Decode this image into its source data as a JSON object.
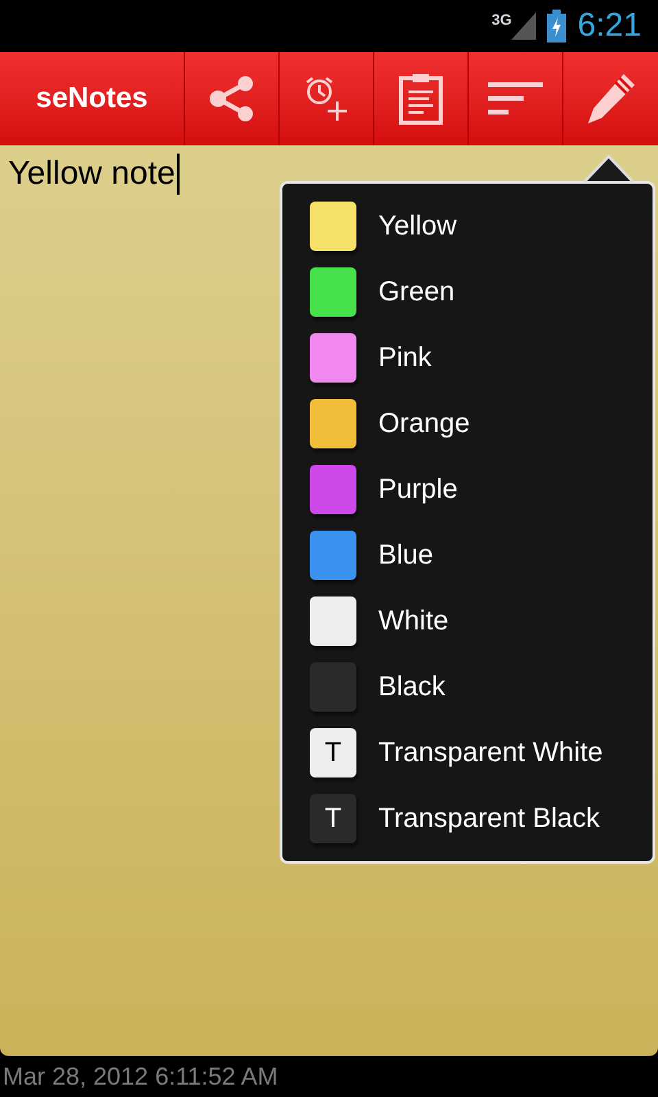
{
  "status_bar": {
    "network": "3G",
    "time": "6:21"
  },
  "toolbar": {
    "title": "seNotes"
  },
  "note": {
    "value": "Yellow note"
  },
  "color_menu": [
    {
      "label": "Yellow",
      "color": "#f5e06a",
      "kind": "plain"
    },
    {
      "label": "Green",
      "color": "#45e04a",
      "kind": "plain"
    },
    {
      "label": "Pink",
      "color": "#f088ee",
      "kind": "plain"
    },
    {
      "label": "Orange",
      "color": "#f2be3a",
      "kind": "plain"
    },
    {
      "label": "Purple",
      "color": "#cc48e8",
      "kind": "plain"
    },
    {
      "label": "Blue",
      "color": "#3a92ee",
      "kind": "plain"
    },
    {
      "label": "White",
      "color": "#eeeeee",
      "kind": "plain"
    },
    {
      "label": "Black",
      "color": "#2a2a2a",
      "kind": "plain"
    },
    {
      "label": "Transparent White",
      "color": "#eeeeee",
      "kind": "transparent",
      "letter": "T"
    },
    {
      "label": "Transparent Black",
      "color": "#2a2a2a",
      "kind": "transparent",
      "letter": "T"
    }
  ],
  "footer": {
    "timestamp": "Mar 28, 2012 6:11:52 AM"
  }
}
